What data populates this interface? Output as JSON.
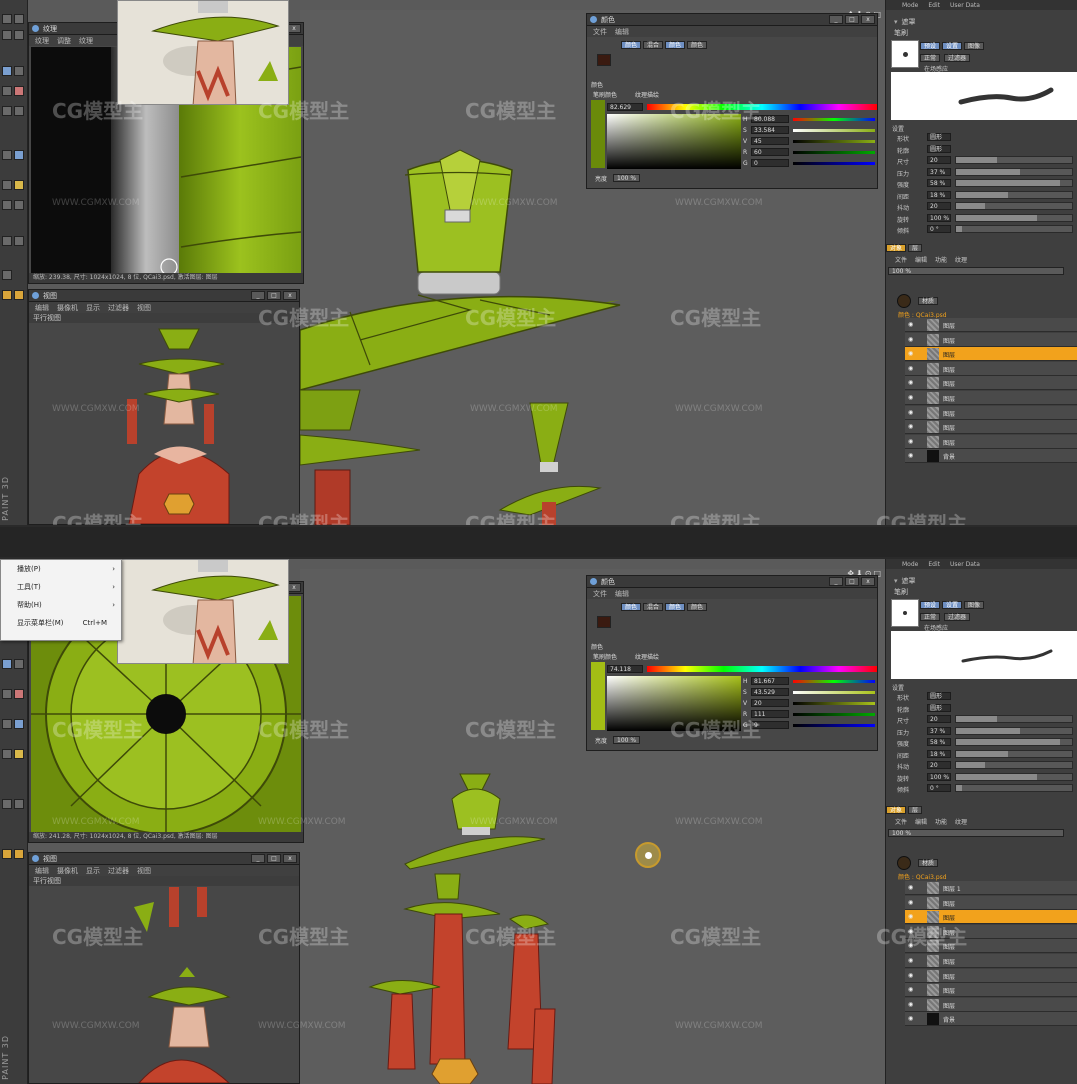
{
  "app": {
    "brand": "PAINT 3D"
  },
  "watermark": {
    "logo": "CG模型主",
    "url": "WWW.CGMXW.COM"
  },
  "right_panel": {
    "top_menu": [
      "Mode",
      "Edit",
      "User Data"
    ],
    "section_title": "笔刷",
    "tab_label": "遮罩",
    "brush_buttons": [
      "预设",
      "设置",
      "图像"
    ],
    "mode": "正常",
    "mode_button": "过滤器",
    "checkbox_label": "在场感应",
    "settings_title": "设置",
    "props": [
      {
        "label": "形状",
        "value": "圆形"
      },
      {
        "label": "轮廓",
        "value": "圆形"
      },
      {
        "label": "尺寸",
        "value": "20"
      },
      {
        "label": "压力",
        "value": "37 %"
      },
      {
        "label": "强度",
        "value": "58 %"
      },
      {
        "label": "间距",
        "value": "18 %"
      },
      {
        "label": "抖动",
        "value": "20"
      },
      {
        "label": "旋转",
        "value": "100 %"
      },
      {
        "label": "倾斜",
        "value": "0 °"
      }
    ],
    "layer_tabs": [
      "对象",
      "层"
    ],
    "layer_menu": [
      "文件",
      "编辑",
      "功能",
      "纹理"
    ],
    "zoom": "100 %",
    "material_label": "材质",
    "texture_label": "颜色 : QCai3.psd",
    "layers_a": [
      "图层",
      "图层",
      "图层",
      "图层",
      "图层",
      "图层",
      "图层",
      "图层",
      "图层",
      "背景"
    ],
    "layers_b": [
      "图层 1",
      "图层",
      "图层",
      "图层",
      "图层",
      "图层",
      "图层",
      "图层",
      "图层",
      "背景"
    ],
    "selected_index": 2
  },
  "color_window": {
    "title": "颜色",
    "menu": [
      "文件",
      "编辑"
    ],
    "tabs": [
      "颜色",
      "混合",
      "颜色",
      "颜色"
    ],
    "section_label": "颜色",
    "options": [
      "笔刷颜色",
      "纹理描绘"
    ],
    "value_label": "亮度",
    "value_pct": "100 %",
    "shot_a": {
      "hex": "82.629",
      "rows": [
        {
          "label": "H",
          "value": "80.088"
        },
        {
          "label": "S",
          "value": "33.584"
        },
        {
          "label": "V",
          "value": "45"
        },
        {
          "label": "R",
          "value": "60"
        },
        {
          "label": "G",
          "value": "0"
        }
      ]
    },
    "shot_b": {
      "hex": "74.118",
      "rows": [
        {
          "label": "H",
          "value": "81.667"
        },
        {
          "label": "S",
          "value": "43.529"
        },
        {
          "label": "V",
          "value": "20"
        },
        {
          "label": "R",
          "value": "111"
        },
        {
          "label": "G",
          "value": "9"
        }
      ]
    }
  },
  "texture_window": {
    "title": "纹理",
    "sub_title": "平行视图",
    "menu": [
      "纹理",
      "调整",
      "纹理"
    ],
    "status_a": "缩放: 239.38, 尺寸: 1024x1024, 8 位, QCai3.psd, 激活图层: 图层",
    "status_b": "缩放: 241.28, 尺寸: 1024x1024, 8 位, QCai3.psd, 激活图层: 图层"
  },
  "view_window": {
    "title": "视图",
    "menu": [
      "编辑",
      "摄像机",
      "显示",
      "过滤器",
      "视图"
    ],
    "sub_title": "平行视图"
  },
  "main_menu": {
    "items": [
      {
        "label": "播放(P)",
        "shortcut": "",
        "has_submenu": true
      },
      {
        "label": "工具(T)",
        "shortcut": "",
        "has_submenu": true
      },
      {
        "label": "帮助(H)",
        "shortcut": "",
        "has_submenu": true
      },
      {
        "label": "显示菜单栏(M)",
        "shortcut": "Ctrl+M",
        "has_submenu": false
      }
    ]
  },
  "colors": {
    "accent": "#f2a21c",
    "leaf_green": "#8aae14",
    "brick_red": "#b8412c"
  }
}
